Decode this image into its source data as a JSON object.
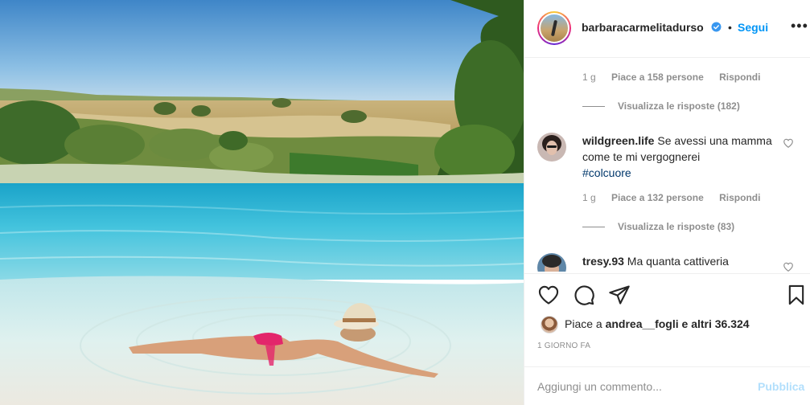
{
  "post": {
    "username": "barbaracarmelitadurso",
    "separator": "•",
    "follow_label": "Segui",
    "more_label": "•••"
  },
  "comments": {
    "reply1": {
      "time": "1 g",
      "likes": "Piace a 158 persone",
      "reply_label": "Rispondi",
      "view_replies": "Visualizza le risposte (182)"
    },
    "comment2": {
      "user": "wildgreen.life",
      "text": "Se avessi una mamma come te mi vergognerei",
      "hashtag": "#colcuore",
      "time": "1 g",
      "likes": "Piace a 132 persone",
      "reply_label": "Rispondi",
      "view_replies": "Visualizza le risposte (83)"
    },
    "comment3": {
      "user": "tresy.93",
      "text": "Ma quanta cattiveria"
    }
  },
  "likes": {
    "prefix": "Piace a",
    "user": "andrea__fogli",
    "suffix": "e altri 36.324"
  },
  "timestamp": "1 GIORNO FA",
  "add_comment": {
    "placeholder": "Aggiungi un commento...",
    "publish_label": "Pubblica"
  },
  "icons": {
    "verified": "verified-badge-icon",
    "like": "heart-icon",
    "comment": "comment-bubble-icon",
    "share": "paper-plane-icon",
    "save": "bookmark-icon"
  },
  "colors": {
    "accent": "#0095f6",
    "muted": "#8e8e8e",
    "publish_disabled": "#b2dffc",
    "text": "#262626"
  }
}
